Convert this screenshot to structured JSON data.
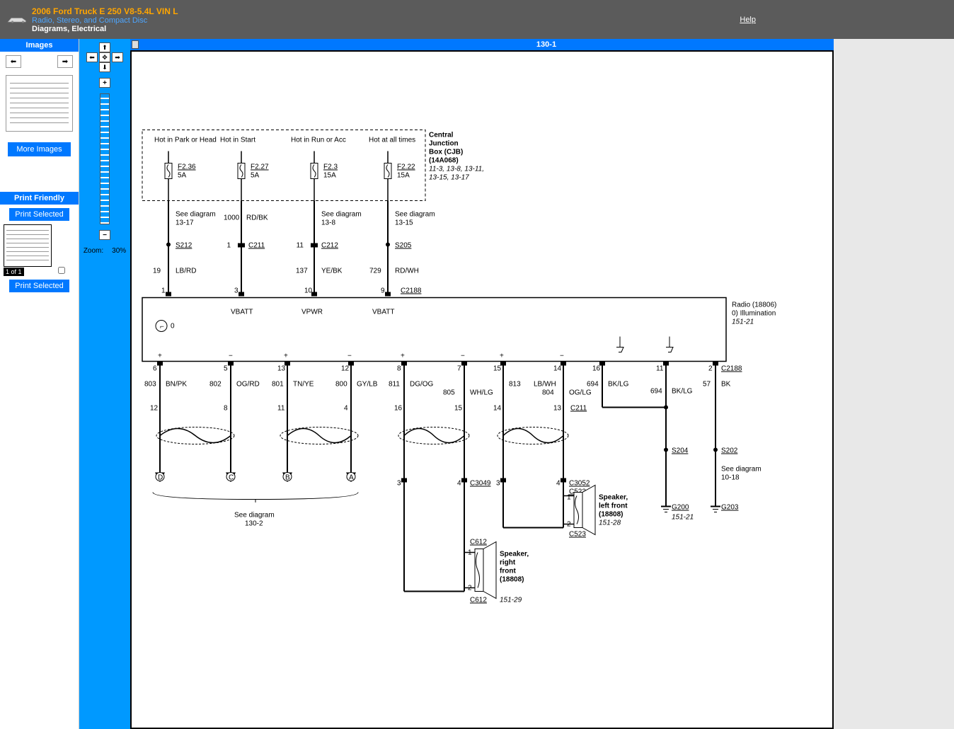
{
  "header": {
    "title": "2006 Ford Truck E 250 V8-5.4L VIN L",
    "subtitle1": "Radio, Stereo, and Compact Disc",
    "subtitle2": "Diagrams, Electrical",
    "help": "Help"
  },
  "sidebar": {
    "images_header": "Images",
    "more_images": "More Images",
    "print_friendly": "Print Friendly",
    "print_selected": "Print Selected",
    "page_indicator": "1 of 1"
  },
  "zoom": {
    "label": "Zoom:",
    "value": "30%"
  },
  "diagram": {
    "title": "130-1",
    "cjb": {
      "name": "Central Junction Box (CJB)",
      "part": "(14A068)",
      "ref": "11-3, 13-8, 13-11, 13-15, 13-17"
    },
    "fuses": [
      {
        "hot": "Hot in Park or Head",
        "fuse": "F2.36",
        "rating": "5A"
      },
      {
        "hot": "Hot in Start",
        "fuse": "F2.27",
        "rating": "5A"
      },
      {
        "hot": "Hot in Run or Acc",
        "fuse": "F2.3",
        "rating": "15A"
      },
      {
        "hot": "Hot at all times",
        "fuse": "F2.22",
        "rating": "15A"
      }
    ],
    "top_refs": [
      "See diagram 13-17",
      "",
      "See diagram 13-8",
      "See diagram 13-15"
    ],
    "top_splices": [
      "S212",
      "C211",
      "C212",
      "S205"
    ],
    "top_splice_left": [
      "",
      "1",
      "11",
      ""
    ],
    "top_wires": [
      "LB/RD",
      "",
      "YE/BK",
      "RD/WH"
    ],
    "top_wire_left": [
      "19",
      "",
      "137",
      "729"
    ],
    "top_pins": [
      "1",
      "3",
      "10",
      "9"
    ],
    "extra_wire": {
      "num": "1000",
      "color": "RD/BK"
    },
    "c2188": "C2188",
    "radio_labels": [
      "VBATT",
      "VPWR",
      "VBATT"
    ],
    "radio": {
      "name": "Radio (18806)",
      "illum": "0) Illumination",
      "ref": "151-21"
    },
    "lock_num": "0",
    "bottom_pins": [
      "6",
      "5",
      "13",
      "12",
      "8",
      "7",
      "15",
      "14",
      "16",
      "11",
      "2"
    ],
    "bottom_wires": [
      {
        "n": "803",
        "c": "BN/PK"
      },
      {
        "n": "802",
        "c": "OG/RD"
      },
      {
        "n": "801",
        "c": "TN/YE"
      },
      {
        "n": "800",
        "c": "GY/LB"
      },
      {
        "n": "811",
        "c": "DG/OG"
      },
      {
        "n": "805",
        "c": "WH/LG"
      },
      {
        "n": "813",
        "c": "LB/WH"
      },
      {
        "n": "804",
        "c": "OG/LG"
      },
      {
        "n": "694",
        "c": "BK/LG"
      },
      {
        "n": "694",
        "c": "BK/LG"
      },
      {
        "n": "57",
        "c": "BK"
      }
    ],
    "mid_pins": [
      "12",
      "8",
      "11",
      "4",
      "16",
      "15",
      "14",
      "13"
    ],
    "c211_bottom": "C211",
    "c2188_bottom": "C2188",
    "arrows": [
      "D",
      "C",
      "B",
      "A"
    ],
    "see_130_2": "See diagram",
    "see_130_2b": "130-2",
    "c3049": "C3049",
    "c3049_pins": [
      "3",
      "4",
      "3",
      "4"
    ],
    "c3052": "C3052",
    "c523": "C523",
    "speaker_lf": {
      "name": "Speaker, left front",
      "part": "(18808)",
      "ref": "151-28"
    },
    "c523b": "C523",
    "c612": "C612",
    "speaker_rf": {
      "name": "Speaker, right front",
      "part": "(18808)",
      "ref": "151-29"
    },
    "c612b": "C612",
    "s204": "S204",
    "s202": "S202",
    "see_10_18": "See diagram",
    "see_10_18b": "10-18",
    "g200": "G200",
    "g200_ref": "151-21",
    "g203": "G203",
    "speaker_pins_lf": [
      "1",
      "2"
    ],
    "speaker_pins_rf": [
      "1",
      "2"
    ]
  }
}
